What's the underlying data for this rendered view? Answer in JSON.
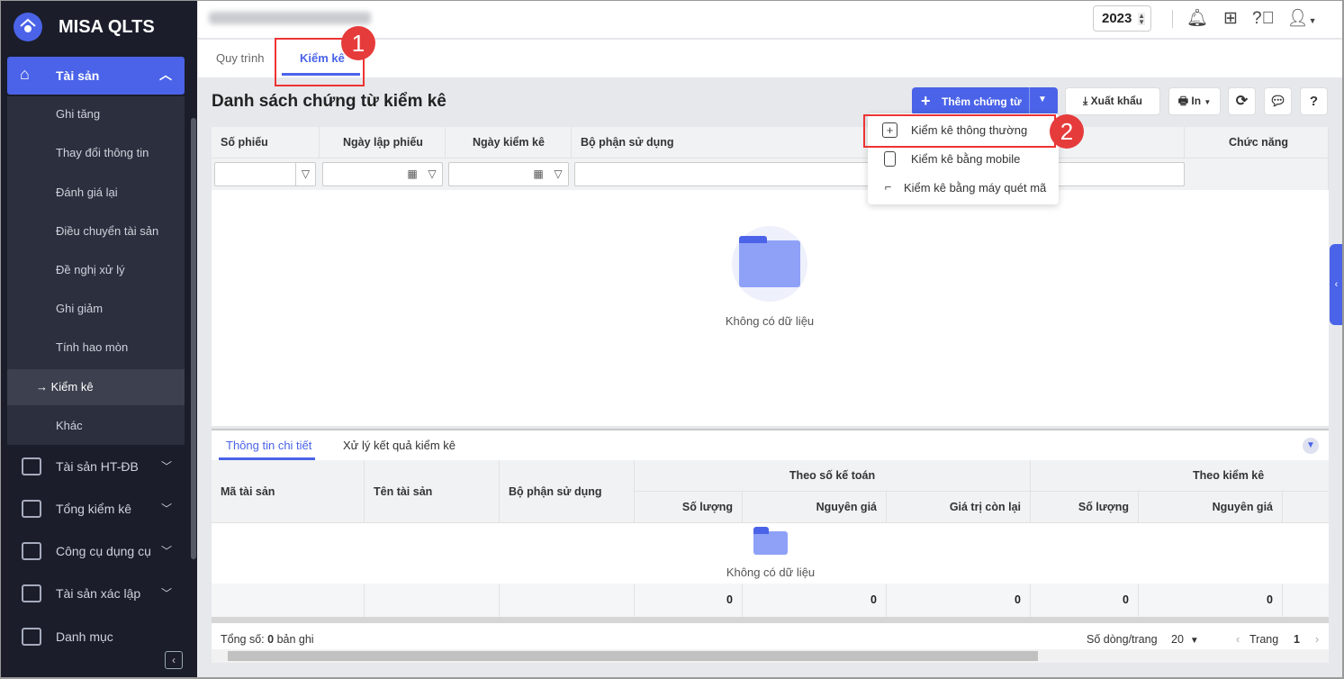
{
  "app": {
    "name": "MISA QLTS"
  },
  "topbar": {
    "year": "2023"
  },
  "sidebar": {
    "main": {
      "label": "Tài sản"
    },
    "sub_items": [
      "Ghi tăng",
      "Thay đổi thông tin",
      "Đánh giá lại",
      "Điều chuyển tài sản",
      "Đề nghị xử lý",
      "Ghi giảm",
      "Tính hao mòn",
      "Kiểm kê",
      "Khác"
    ],
    "active_prefix": "→",
    "groups": [
      "Tài sản HT-ĐB",
      "Tổng kiểm kê",
      "Công cụ dụng cụ",
      "Tài sản xác lập",
      "Danh mục"
    ]
  },
  "tabs": [
    "Quy trình",
    "Kiểm kê"
  ],
  "annotations": [
    "1",
    "2"
  ],
  "page": {
    "title": "Danh sách chứng từ kiểm kê"
  },
  "toolbar": {
    "add": "Thêm chứng từ",
    "export": "Xuất khẩu",
    "print": "In"
  },
  "add_menu": [
    "Kiểm kê thông thường",
    "Kiểm kê bằng mobile",
    "Kiểm kê bằng máy quét mã"
  ],
  "grid": {
    "columns": [
      "Số phiếu",
      "Ngày lập phiếu",
      "Ngày kiểm kê",
      "Bộ phận sử dụng",
      "Chức năng"
    ],
    "empty": "Không có dữ liệu"
  },
  "detail": {
    "tabs": [
      "Thông tin chi tiết",
      "Xử lý kết quả kiểm kê"
    ],
    "columns": [
      "Mã tài sản",
      "Tên tài sản",
      "Bộ phận sử dụng"
    ],
    "group1": "Theo số kế toán",
    "group2": "Theo kiểm kê",
    "sub_columns": [
      "Số lượng",
      "Nguyên giá",
      "Giá trị còn lại",
      "Số lượng",
      "Nguyên giá"
    ],
    "totals": [
      "0",
      "0",
      "0",
      "0",
      "0"
    ],
    "empty": "Không có dữ liệu"
  },
  "footer": {
    "total_prefix": "Tổng số:",
    "total_count": "0",
    "total_suffix": "bản ghi",
    "rows_label": "Số dòng/trang",
    "rows_value": "20",
    "page_label": "Trang",
    "page_value": "1"
  },
  "colors": {
    "accent": "#4a63e8",
    "sidebar": "#1b1d2a",
    "annotation": "#e63b3b"
  }
}
